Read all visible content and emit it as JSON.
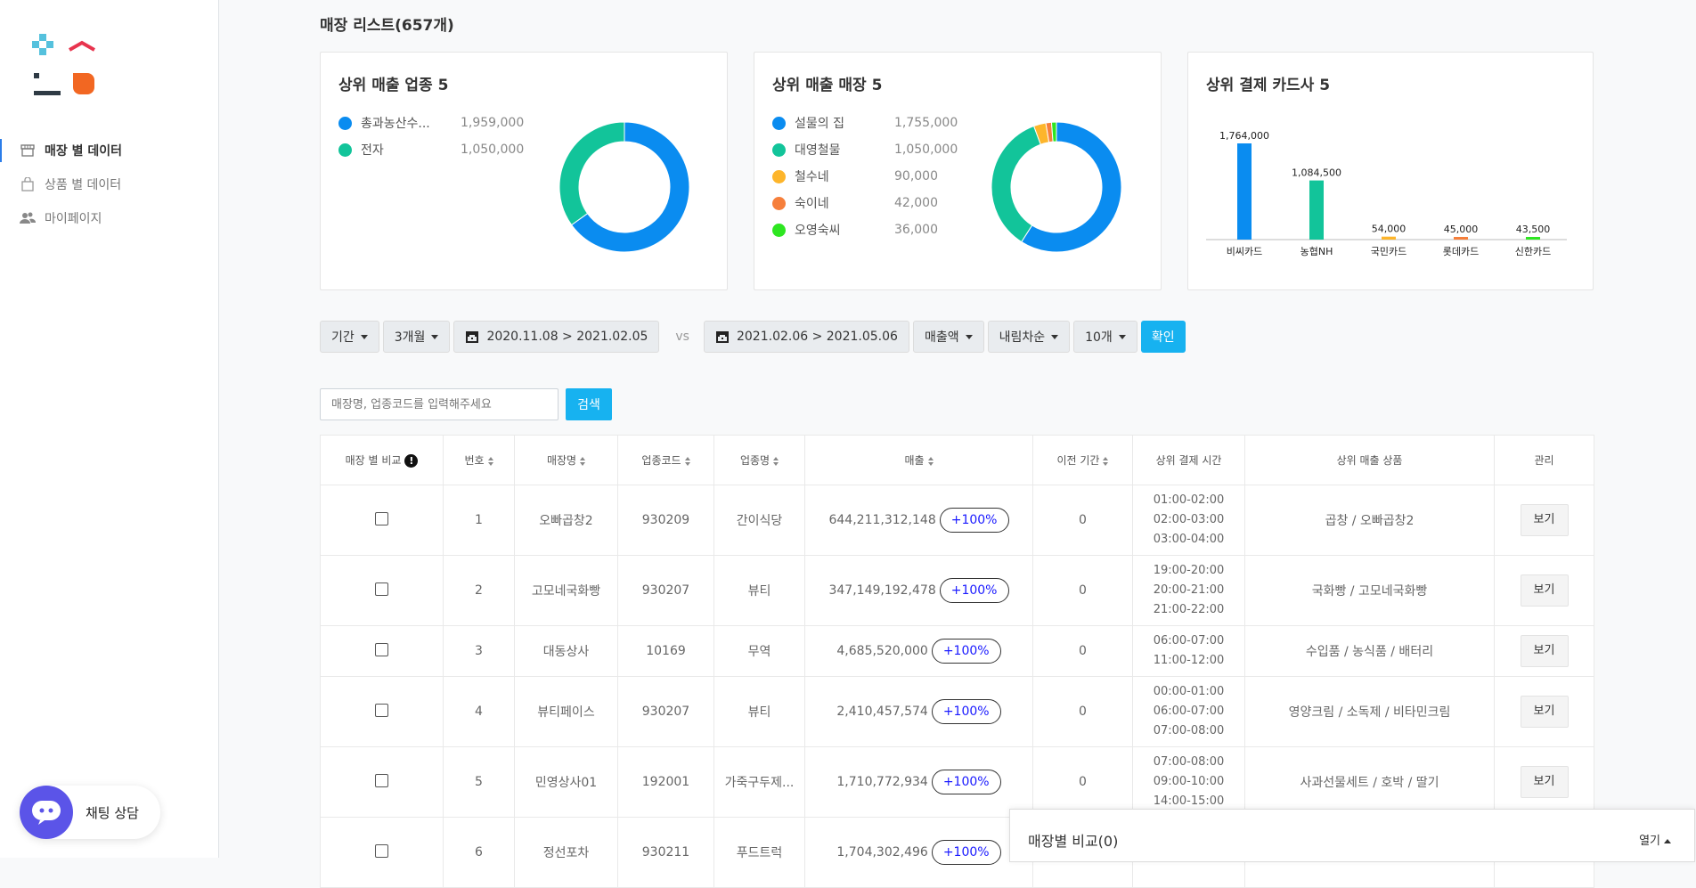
{
  "sidebar": {
    "items": [
      {
        "label": "매장 별 데이터",
        "active": true,
        "icon": "store-icon"
      },
      {
        "label": "상품 별 데이터",
        "active": false,
        "icon": "shopping-bag-icon"
      },
      {
        "label": "마이페이지",
        "active": false,
        "icon": "users-icon"
      }
    ],
    "chat_label": "채팅 상담"
  },
  "page_title": "매장 리스트(657개)",
  "cards": {
    "industry": {
      "title": "상위 매출 업종 5",
      "legend": [
        {
          "name": "총과농산수...",
          "value": "1,959,000",
          "color": "#0a8cf0"
        },
        {
          "name": "전자",
          "value": "1,050,000",
          "color": "#12c49a"
        }
      ]
    },
    "store": {
      "title": "상위 매출 매장 5",
      "legend": [
        {
          "name": "설물의 집",
          "value": "1,755,000",
          "color": "#0a8cf0"
        },
        {
          "name": "대영철물",
          "value": "1,050,000",
          "color": "#12c49a"
        },
        {
          "name": "철수네",
          "value": "90,000",
          "color": "#fdb52b"
        },
        {
          "name": "숙이네",
          "value": "42,000",
          "color": "#f67f3b"
        },
        {
          "name": "오영숙씨",
          "value": "36,000",
          "color": "#2ee621"
        }
      ]
    },
    "card_company": {
      "title": "상위 결제 카드사 5"
    }
  },
  "chart_data": [
    {
      "type": "pie",
      "title": "상위 매출 업종 5",
      "labels": [
        "총과농산수...",
        "전자"
      ],
      "values": [
        1959000,
        1050000
      ],
      "colors": [
        "#0a8cf0",
        "#12c49a"
      ]
    },
    {
      "type": "pie",
      "title": "상위 매출 매장 5",
      "labels": [
        "설물의 집",
        "대영철물",
        "철수네",
        "숙이네",
        "오영숙씨"
      ],
      "values": [
        1755000,
        1050000,
        90000,
        42000,
        36000
      ],
      "colors": [
        "#0a8cf0",
        "#12c49a",
        "#fdb52b",
        "#f67f3b",
        "#2ee621"
      ]
    },
    {
      "type": "bar",
      "title": "상위 결제 카드사 5",
      "categories": [
        "비씨카드",
        "농협NH",
        "국민카드",
        "롯데카드",
        "신한카드"
      ],
      "values": [
        1764000,
        1084500,
        54000,
        45000,
        43500
      ],
      "value_labels": [
        "1,764,000",
        "1,084,500",
        "54,000",
        "45,000",
        "43,500"
      ],
      "colors": [
        "#0a8cf0",
        "#12c49a",
        "#fdb52b",
        "#f67f3b",
        "#2ee621"
      ]
    }
  ],
  "filters": {
    "period": "기간",
    "range": "3개월",
    "date_a": "2020.11.08 > 2021.02.05",
    "vs": "vs",
    "date_b": "2021.02.06 > 2021.05.06",
    "metric": "매출액",
    "order": "내림차순",
    "count": "10개",
    "confirm": "확인"
  },
  "search": {
    "placeholder": "매장명, 업종코드를 입력해주세요",
    "button": "검색"
  },
  "table": {
    "headers": {
      "compare": "매장 별 비교",
      "no": "번호",
      "name": "매장명",
      "code": "업종코드",
      "type": "업종명",
      "sales": "매출",
      "prev": "이전 기간",
      "time": "상위 결제 시간",
      "product": "상위 매출 상품",
      "manage": "관리"
    },
    "rows": [
      {
        "no": "1",
        "name": "오빠곱창2",
        "code": "930209",
        "type": "간이식당",
        "sales": "644,211,312,148",
        "pct": "+100%",
        "prev": "0",
        "times": [
          "01:00-02:00",
          "02:00-03:00",
          "03:00-04:00"
        ],
        "product": "곱창 / 오빠곱창2",
        "view": "보기"
      },
      {
        "no": "2",
        "name": "고모네국화빵",
        "code": "930207",
        "type": "뷰티",
        "sales": "347,149,192,478",
        "pct": "+100%",
        "prev": "0",
        "times": [
          "19:00-20:00",
          "20:00-21:00",
          "21:00-22:00"
        ],
        "product": "국화빵 / 고모네국화빵",
        "view": "보기"
      },
      {
        "no": "3",
        "name": "대동상사",
        "code": "10169",
        "type": "무역",
        "sales": "4,685,520,000",
        "pct": "+100%",
        "prev": "0",
        "times": [
          "06:00-07:00",
          "11:00-12:00"
        ],
        "product": "수입품 / 농식품 / 배터리",
        "view": "보기"
      },
      {
        "no": "4",
        "name": "뷰티페이스",
        "code": "930207",
        "type": "뷰티",
        "sales": "2,410,457,574",
        "pct": "+100%",
        "prev": "0",
        "times": [
          "00:00-01:00",
          "06:00-07:00",
          "07:00-08:00"
        ],
        "product": "영양크림 / 소독제 / 비타민크림",
        "view": "보기"
      },
      {
        "no": "5",
        "name": "민영상사01",
        "code": "192001",
        "type": "가죽구두제...",
        "sales": "1,710,772,934",
        "pct": "+100%",
        "prev": "0",
        "times": [
          "07:00-08:00",
          "09:00-10:00",
          "14:00-15:00"
        ],
        "product": "사과선물세트 / 호박 / 딸기",
        "view": "보기"
      },
      {
        "no": "6",
        "name": "정선포차",
        "code": "930211",
        "type": "푸드트럭",
        "sales": "1,704,302,496",
        "pct": "+100%",
        "prev": "",
        "times": [],
        "product": "",
        "view": ""
      }
    ]
  },
  "compare_panel": {
    "title": "매장별 비교(0)",
    "toggle": "열기"
  }
}
